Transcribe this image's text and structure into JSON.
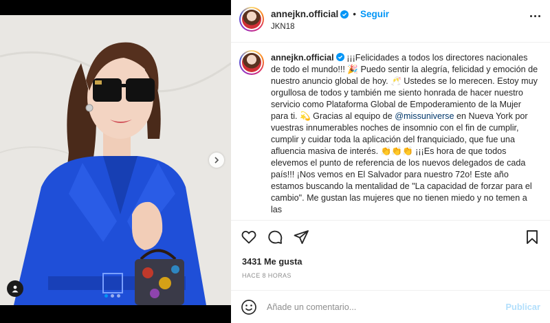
{
  "post": {
    "username": "annejkn.official",
    "verified": true,
    "separator": "•",
    "follow_label": "Seguir",
    "location": "JKN18"
  },
  "caption": {
    "username": "annejkn.official",
    "text_1": "¡¡¡Felicidades a todos los directores nacionales de todo el mundo!!! 🎉 Puedo sentir la alegría, felicidad y emoción de nuestro anuncio global de hoy. 🥂 Ustedes se lo merecen. Estoy muy orgullosa de todos y también me siento honrada de hacer nuestro servicio como Plataforma Global de Empoderamiento de la Mujer para ti. 💫 Gracias al equipo de ",
    "mention": "@missuniverse",
    "text_2": " en Nueva York por vuestras innumerables noches de insomnio con el fin de cumplir, cumplir y cuidar toda la aplicación del franquiciado, que fue una afluencia masiva de interés. 👏👏👏 ¡¡¡Es hora de que todos elevemos el punto de referencia de los nuevos delegados de cada país!!! ¡Nos vemos en El Salvador para nuestro 72o! Este año estamos buscando la mentalidad de \"La capacidad de forzar para el cambio\". Me gustan las mujeres que no tienen miedo y no temen a las"
  },
  "actions": {
    "like_icon": "heart-icon",
    "comment_icon": "comment-icon",
    "share_icon": "paper-plane-icon",
    "save_icon": "bookmark-icon"
  },
  "stats": {
    "likes": "3431 Me gusta",
    "time": "HACE 8 HORAS"
  },
  "comment_box": {
    "placeholder": "Añade un comentario...",
    "publish_label": "Publicar"
  },
  "carousel": {
    "total": 3,
    "active_index": 0
  },
  "colors": {
    "link_blue": "#0095f6",
    "publish_disabled": "#b2dffc",
    "mention": "#00376b",
    "suit_blue": "#1f4fd8"
  }
}
